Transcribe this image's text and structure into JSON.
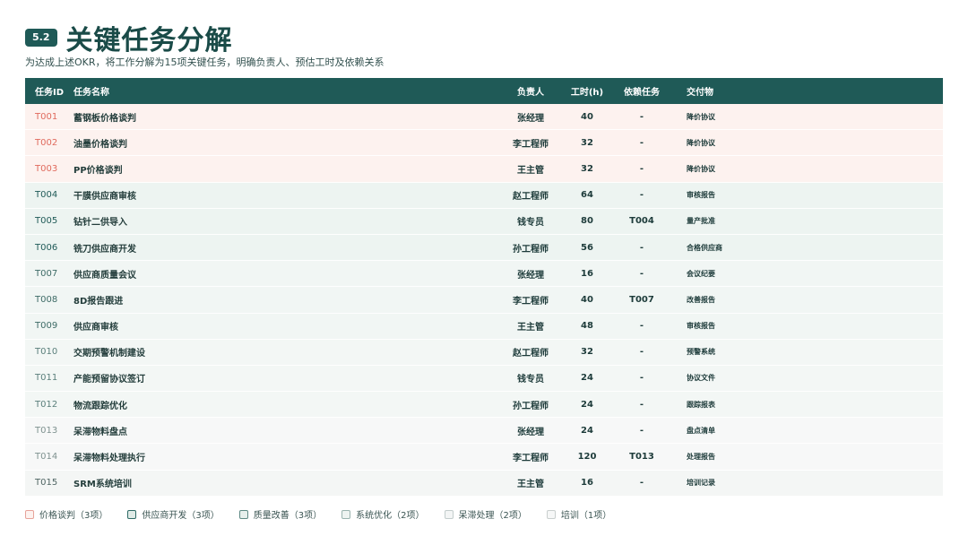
{
  "header": {
    "badge": "5.2",
    "title": "关键任务分解",
    "subtitle": "为达成上述OKR，将工作分解为15项关键任务，明确负责人、预估工时及依赖关系"
  },
  "table": {
    "headers": {
      "id": "任务ID",
      "name": "任务名称",
      "owner": "负责人",
      "hours": "工时(h)",
      "dep": "依赖任务",
      "deliverable": "交付物"
    },
    "rows": [
      {
        "id": "T001",
        "name": "蓄钢板价格谈判",
        "owner": "张经理",
        "hours": "40",
        "dep": "-",
        "deliverable": "降价协议",
        "group": "price"
      },
      {
        "id": "T002",
        "name": "油墨价格谈判",
        "owner": "李工程师",
        "hours": "32",
        "dep": "-",
        "deliverable": "降价协议",
        "group": "price"
      },
      {
        "id": "T003",
        "name": "PP价格谈判",
        "owner": "王主管",
        "hours": "32",
        "dep": "-",
        "deliverable": "降价协议",
        "group": "price"
      },
      {
        "id": "T004",
        "name": "干膜供应商审核",
        "owner": "赵工程师",
        "hours": "64",
        "dep": "-",
        "deliverable": "审核报告",
        "group": "supplier"
      },
      {
        "id": "T005",
        "name": "钻针二供导入",
        "owner": "钱专员",
        "hours": "80",
        "dep": "T004",
        "deliverable": "量产批准",
        "group": "supplier"
      },
      {
        "id": "T006",
        "name": "铣刀供应商开发",
        "owner": "孙工程师",
        "hours": "56",
        "dep": "-",
        "deliverable": "合格供应商",
        "group": "supplier"
      },
      {
        "id": "T007",
        "name": "供应商质量会议",
        "owner": "张经理",
        "hours": "16",
        "dep": "-",
        "deliverable": "会议纪要",
        "group": "quality"
      },
      {
        "id": "T008",
        "name": "8D报告跟进",
        "owner": "李工程师",
        "hours": "40",
        "dep": "T007",
        "deliverable": "改善报告",
        "group": "quality"
      },
      {
        "id": "T009",
        "name": "供应商审核",
        "owner": "王主管",
        "hours": "48",
        "dep": "-",
        "deliverable": "审核报告",
        "group": "quality"
      },
      {
        "id": "T010",
        "name": "交期预警机制建设",
        "owner": "赵工程师",
        "hours": "32",
        "dep": "-",
        "deliverable": "预警系统",
        "group": "system"
      },
      {
        "id": "T011",
        "name": "产能预留协议签订",
        "owner": "钱专员",
        "hours": "24",
        "dep": "-",
        "deliverable": "协议文件",
        "group": "system"
      },
      {
        "id": "T012",
        "name": "物流跟踪优化",
        "owner": "孙工程师",
        "hours": "24",
        "dep": "-",
        "deliverable": "跟踪报表",
        "group": "system"
      },
      {
        "id": "T013",
        "name": "呆滞物料盘点",
        "owner": "张经理",
        "hours": "24",
        "dep": "-",
        "deliverable": "盘点清单",
        "group": "stale"
      },
      {
        "id": "T014",
        "name": "呆滞物料处理执行",
        "owner": "李工程师",
        "hours": "120",
        "dep": "T013",
        "deliverable": "处理报告",
        "group": "stale"
      },
      {
        "id": "T015",
        "name": "SRM系统培训",
        "owner": "王主管",
        "hours": "16",
        "dep": "-",
        "deliverable": "培训记录",
        "group": "train"
      }
    ]
  },
  "legend": [
    {
      "label": "价格谈判（3项）",
      "border": "#e7a39a",
      "fill": "#fdf2ef"
    },
    {
      "label": "供应商开发（3项）",
      "border": "#2f6b66",
      "fill": "#dfeae6"
    },
    {
      "label": "质量改善（3项）",
      "border": "#5f8a85",
      "fill": "#e7efec"
    },
    {
      "label": "系统优化（2项）",
      "border": "#9ab3af",
      "fill": "#eef3f1"
    },
    {
      "label": "呆滞处理（2项）",
      "border": "#c3cdcc",
      "fill": "#f3f5f5"
    },
    {
      "label": "培训（1项）",
      "border": "#c9cfce",
      "fill": "#f6f7f7"
    }
  ]
}
